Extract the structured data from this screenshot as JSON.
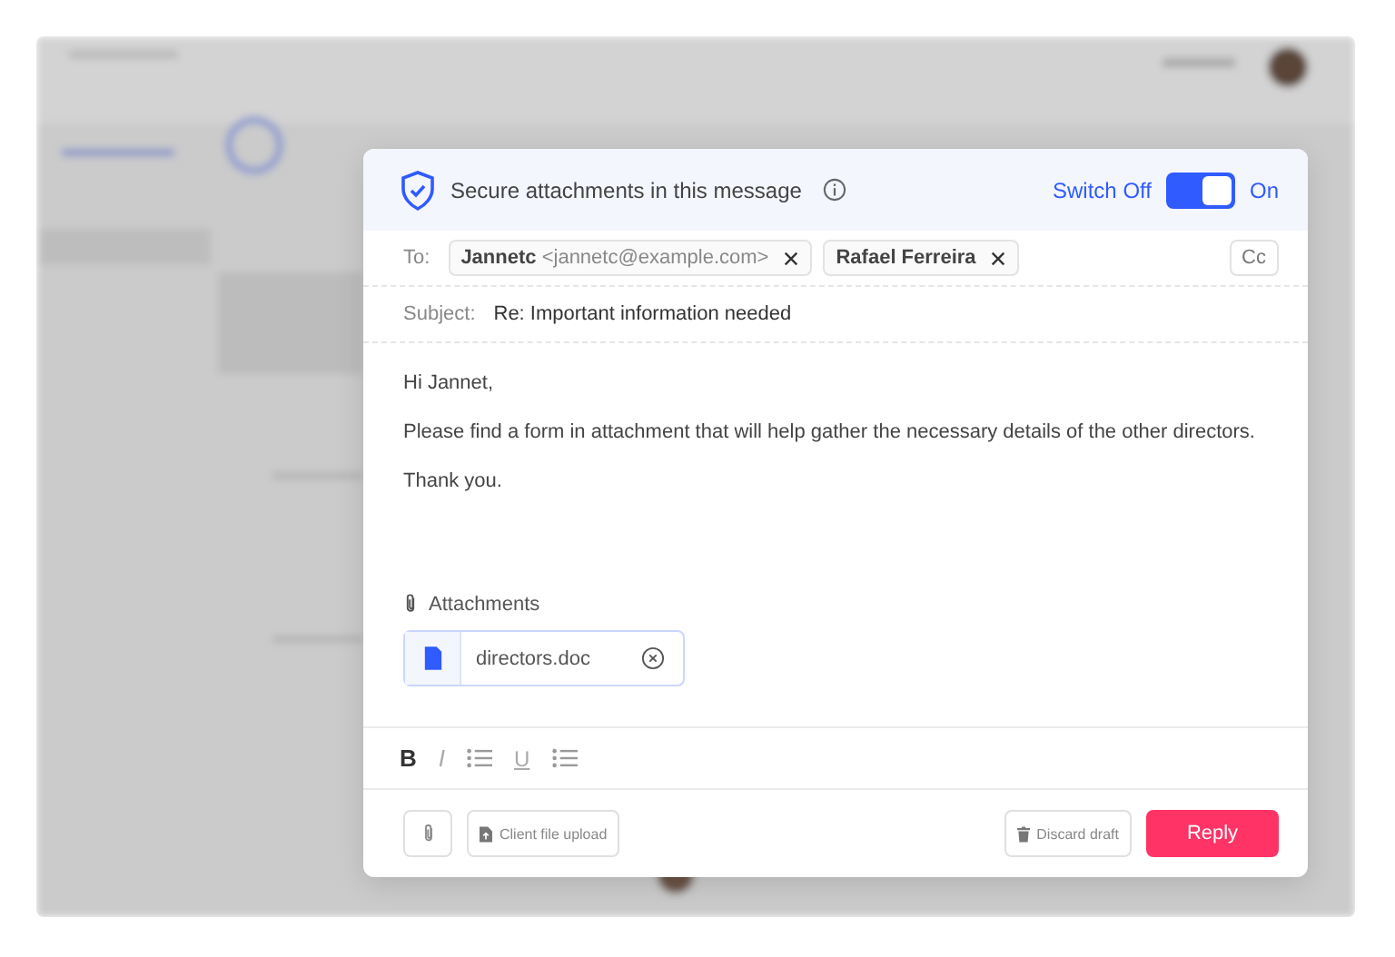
{
  "security": {
    "label": "Secure attachments in this message",
    "switch_label": "Switch Off",
    "state_label": "On",
    "on": true
  },
  "to": {
    "label": "To:",
    "recipients": [
      {
        "name": "Jannetc",
        "email": "<jannetc@example.com>"
      },
      {
        "name": "Rafael Ferreira"
      }
    ],
    "cc": "Cc"
  },
  "subject": {
    "label": "Subject:",
    "value": "Re: Important information needed"
  },
  "body": [
    "Hi Jannet,",
    "Please find a form in attachment that will help gather the necessary details of the other directors.",
    "Thank you."
  ],
  "attachments": {
    "label": "Attachments",
    "files": [
      {
        "name": "directors.doc"
      }
    ]
  },
  "format_tools": [
    {
      "kind": "bold",
      "label": "B"
    },
    {
      "kind": "italic",
      "label": "I"
    },
    {
      "kind": "list"
    },
    {
      "kind": "underline",
      "label": "U"
    },
    {
      "kind": "list"
    }
  ],
  "footer": {
    "upload": "Client file upload",
    "discard": "Discard draft",
    "reply": "Reply"
  }
}
